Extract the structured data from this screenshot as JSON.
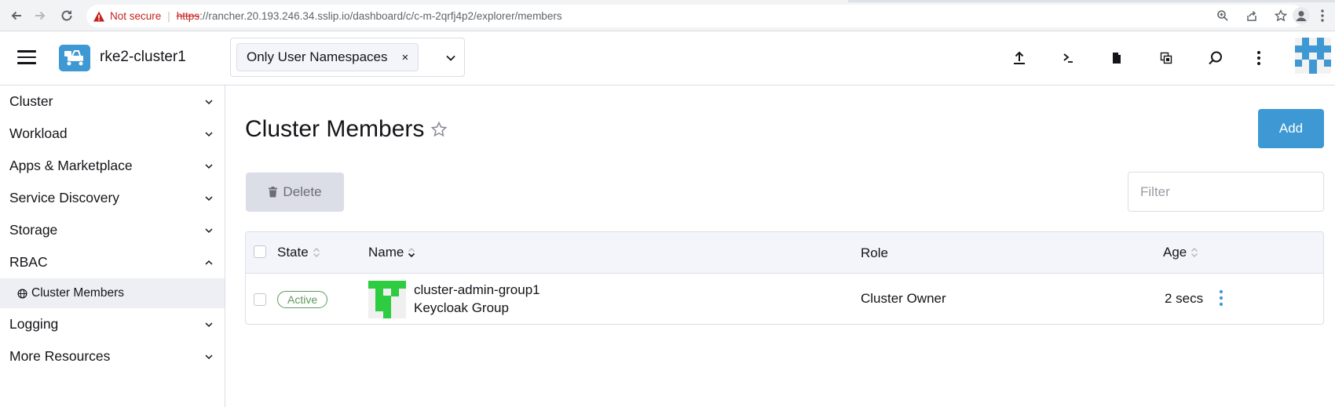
{
  "browser": {
    "not_secure": "Not secure",
    "url_scheme": "https",
    "url_rest": "://rancher.20.193.246.34.sslip.io/dashboard/c/c-m-2qrfj4p2/explorer/members"
  },
  "header": {
    "cluster_name": "rke2-cluster1",
    "namespace_filter": "Only User Namespaces",
    "namespace_clear": "×"
  },
  "sidebar": {
    "items": [
      {
        "label": "Cluster"
      },
      {
        "label": "Workload"
      },
      {
        "label": "Apps & Marketplace"
      },
      {
        "label": "Service Discovery"
      },
      {
        "label": "Storage"
      },
      {
        "label": "RBAC"
      },
      {
        "label": "Logging"
      },
      {
        "label": "More Resources"
      }
    ],
    "sub_item": "Cluster Members"
  },
  "main": {
    "title": "Cluster Members",
    "add_label": "Add",
    "delete_label": "Delete",
    "filter_placeholder": "Filter"
  },
  "table": {
    "columns": {
      "state": "State",
      "name": "Name",
      "role": "Role",
      "age": "Age"
    },
    "rows": [
      {
        "state": "Active",
        "name": "cluster-admin-group1",
        "type": "Keycloak Group",
        "role": "Cluster Owner",
        "age": "2 secs"
      }
    ]
  },
  "colors": {
    "accent": "#3d98d3",
    "active_badge": "#5d995d",
    "avatar_green": "#2ecc40"
  }
}
